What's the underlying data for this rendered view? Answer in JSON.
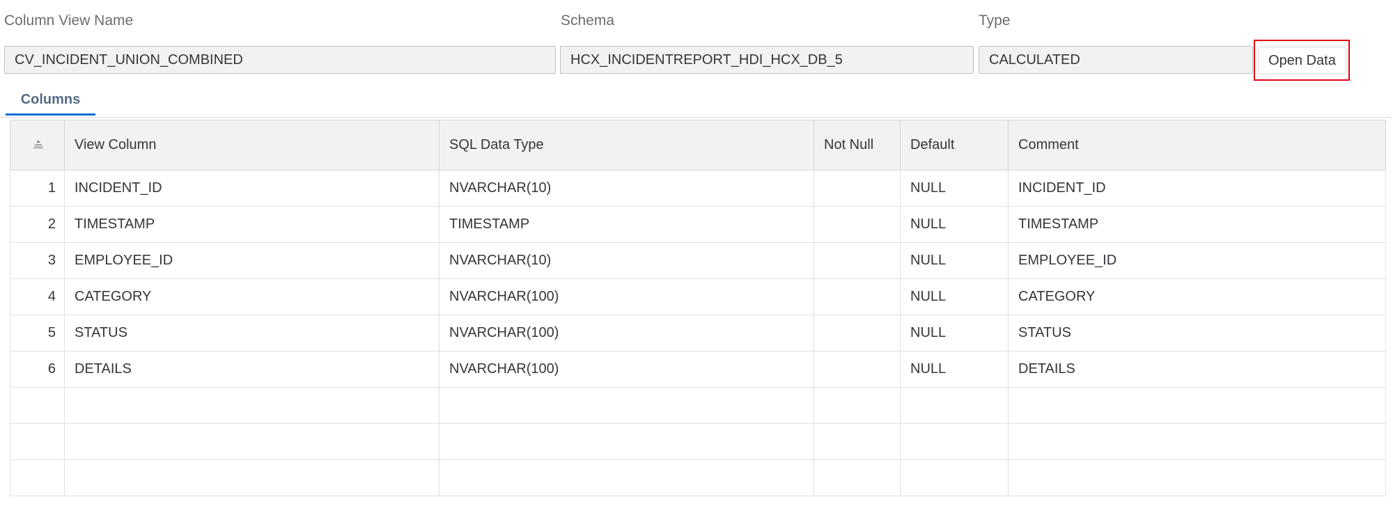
{
  "header": {
    "view_label": "Column View Name",
    "view_value": "CV_INCIDENT_UNION_COMBINED",
    "schema_label": "Schema",
    "schema_value": "HCX_INCIDENTREPORT_HDI_HCX_DB_5",
    "type_label": "Type",
    "type_value": "CALCULATED",
    "open_data_label": "Open Data"
  },
  "tabs": [
    {
      "label": "Columns",
      "active": true
    }
  ],
  "table": {
    "columns": [
      "View Column",
      "SQL Data Type",
      "Not Null",
      "Default",
      "Comment"
    ],
    "rows": [
      {
        "num": "1",
        "view_column": "INCIDENT_ID",
        "sql_type": "NVARCHAR(10)",
        "not_null": "",
        "default": "NULL",
        "comment": "INCIDENT_ID"
      },
      {
        "num": "2",
        "view_column": "TIMESTAMP",
        "sql_type": "TIMESTAMP",
        "not_null": "",
        "default": "NULL",
        "comment": "TIMESTAMP"
      },
      {
        "num": "3",
        "view_column": "EMPLOYEE_ID",
        "sql_type": "NVARCHAR(10)",
        "not_null": "",
        "default": "NULL",
        "comment": "EMPLOYEE_ID"
      },
      {
        "num": "4",
        "view_column": "CATEGORY",
        "sql_type": "NVARCHAR(100)",
        "not_null": "",
        "default": "NULL",
        "comment": "CATEGORY"
      },
      {
        "num": "5",
        "view_column": "STATUS",
        "sql_type": "NVARCHAR(100)",
        "not_null": "",
        "default": "NULL",
        "comment": "STATUS"
      },
      {
        "num": "6",
        "view_column": "DETAILS",
        "sql_type": "NVARCHAR(100)",
        "not_null": "",
        "default": "NULL",
        "comment": "DETAILS"
      }
    ],
    "empty_rows": 3
  },
  "icons": {
    "sort": "sort-icon"
  },
  "colors": {
    "highlight_frame": "#e0000f",
    "tab_indicator": "#0a6ed1",
    "header_bg": "#f2f2f2"
  }
}
